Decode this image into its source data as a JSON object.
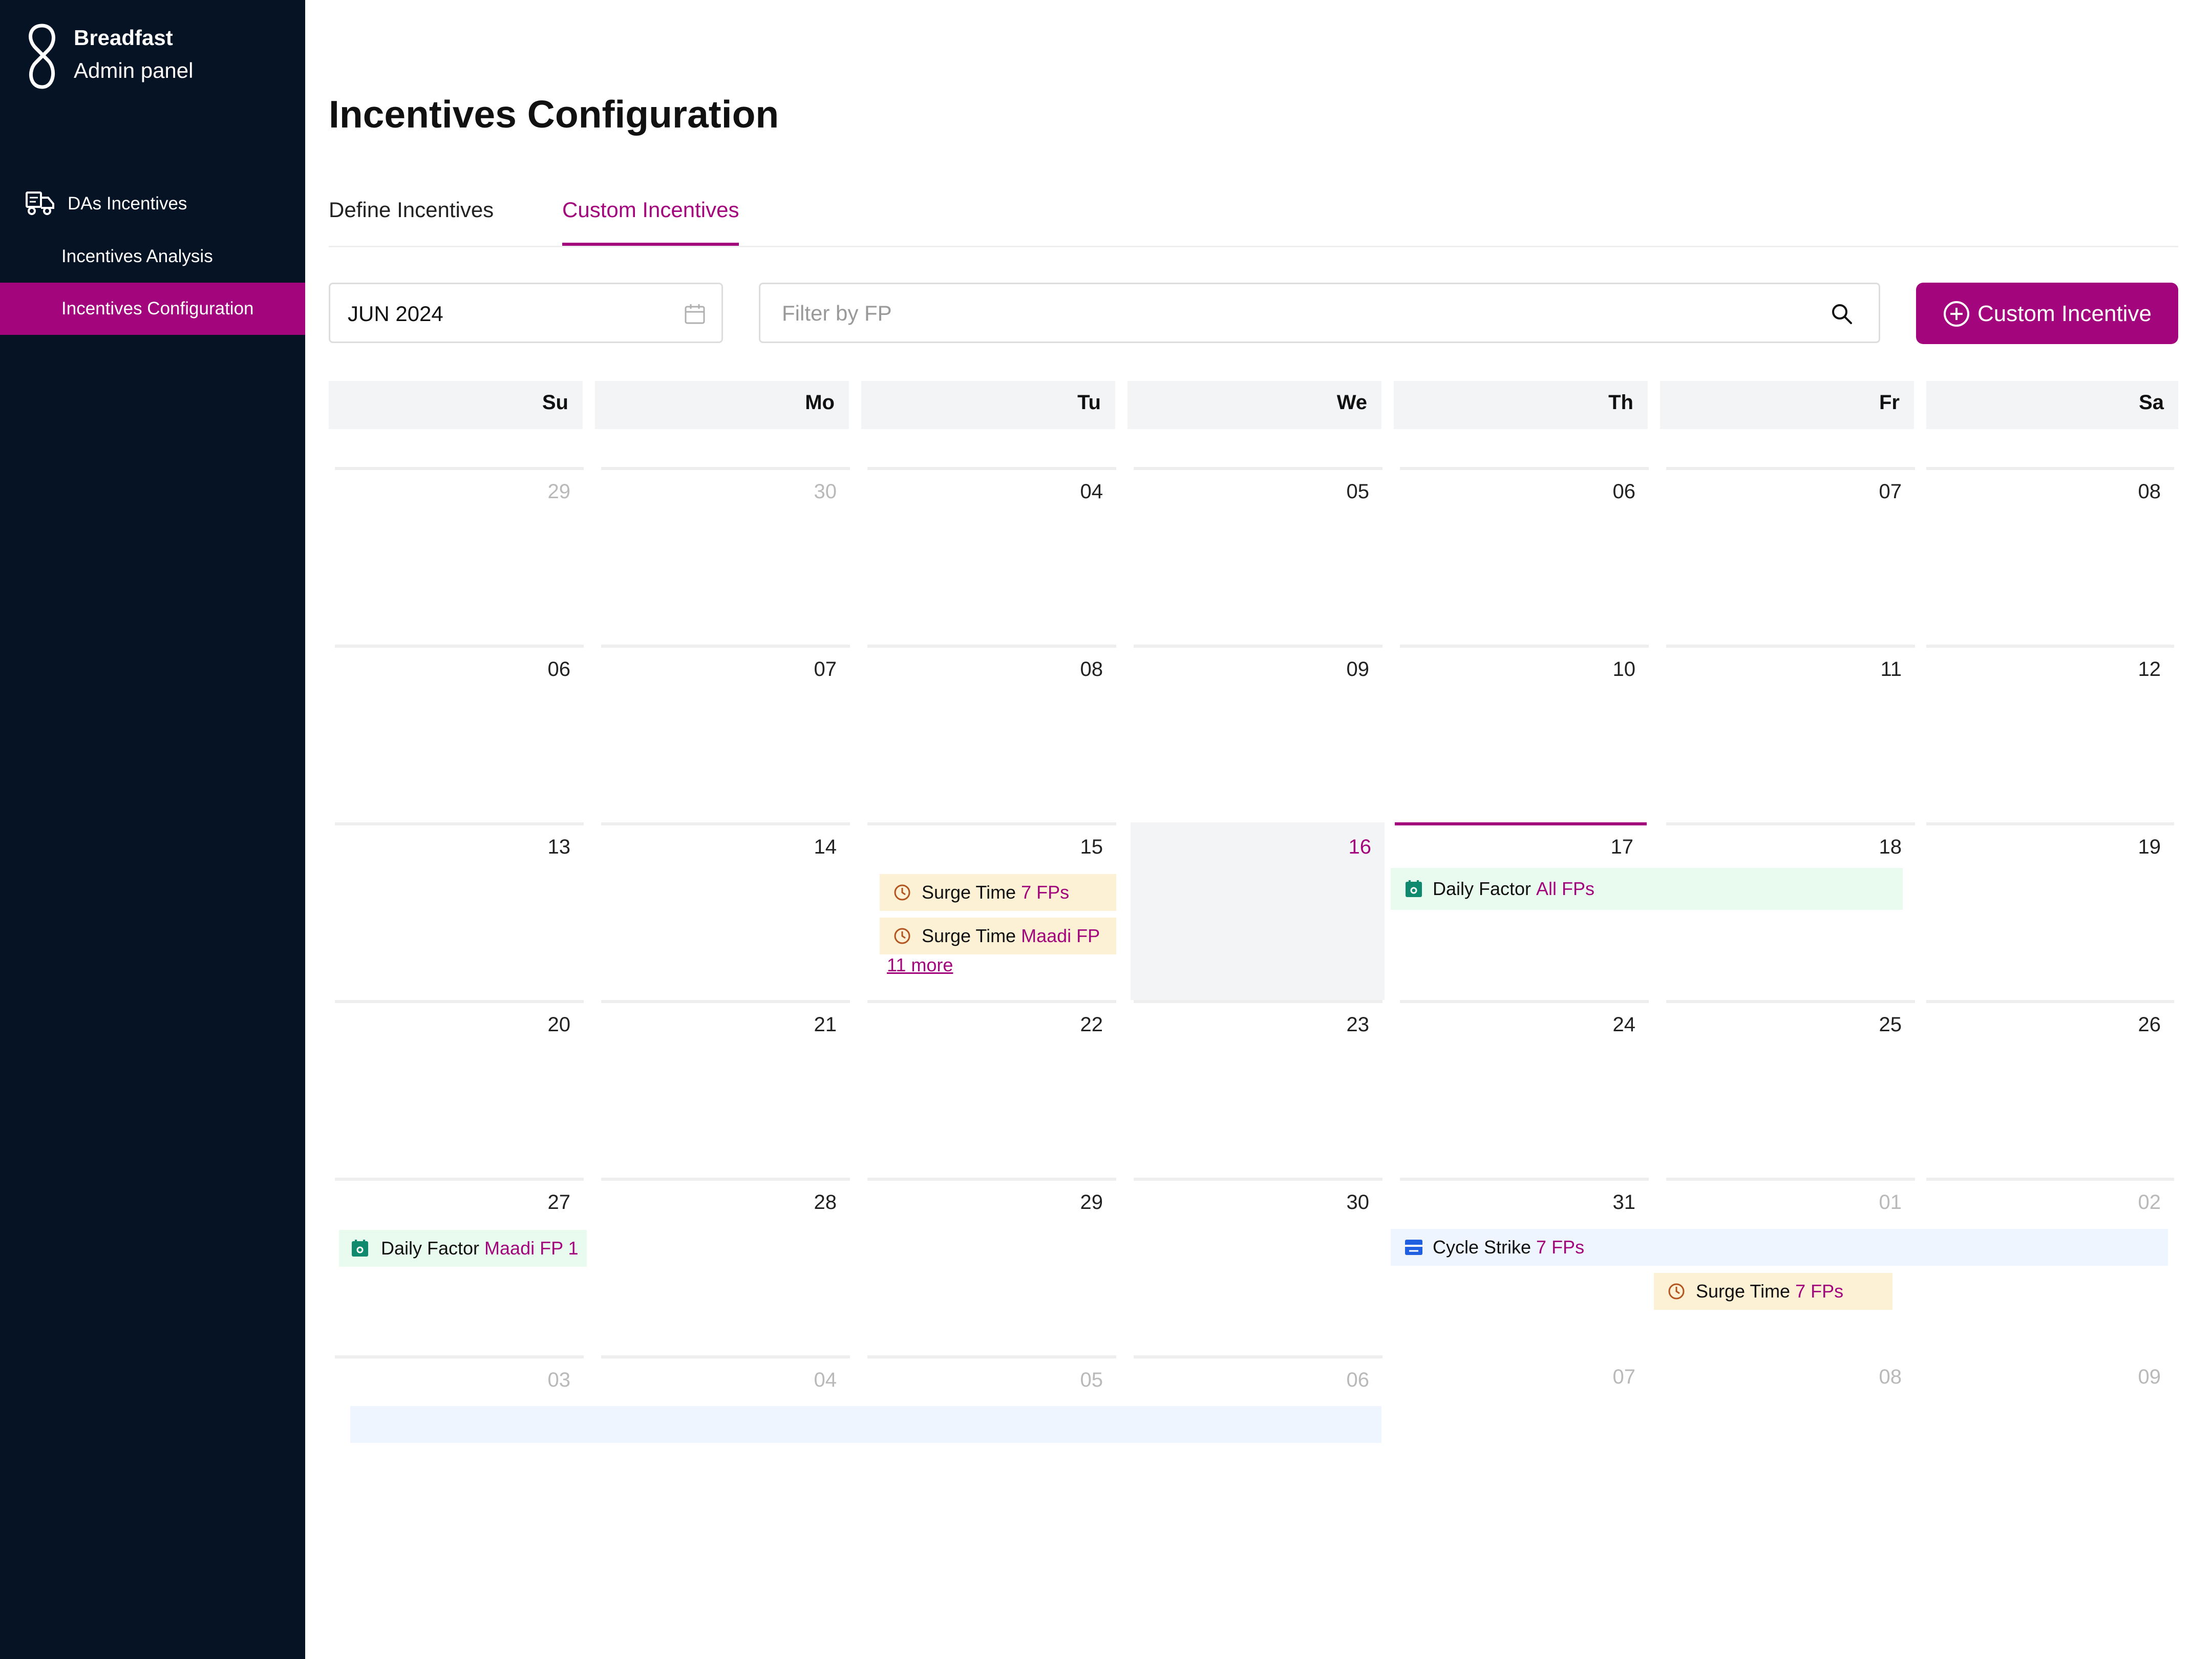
{
  "brand": {
    "name": "Breadfast",
    "subtitle": "Admin panel"
  },
  "sidebar": {
    "section": "DAs Incentives",
    "items": [
      {
        "label": "Incentives Analysis",
        "active": false
      },
      {
        "label": "Incentives Configuration",
        "active": true
      }
    ]
  },
  "page": {
    "title": "Incentives Configuration"
  },
  "tabs": [
    {
      "label": "Define Incentives",
      "active": false
    },
    {
      "label": "Custom Incentives",
      "active": true
    }
  ],
  "toolbar": {
    "month": "JUN 2024",
    "filter_placeholder": "Filter by FP",
    "add_label": "Custom Incentive"
  },
  "colors": {
    "accent": "#a3067c",
    "sidebar_bg": "#051324",
    "surge_bg": "#fcf1d4",
    "daily_bg": "#e8fbee",
    "cycle_bg": "#eef5fe"
  },
  "calendar": {
    "weekdays": [
      "Su",
      "Mo",
      "Tu",
      "We",
      "Th",
      "Fr",
      "Sa"
    ],
    "weeks": [
      [
        {
          "d": "29",
          "muted": true
        },
        {
          "d": "30",
          "muted": true
        },
        {
          "d": "04"
        },
        {
          "d": "05"
        },
        {
          "d": "06"
        },
        {
          "d": "07"
        },
        {
          "d": "08"
        }
      ],
      [
        {
          "d": "06"
        },
        {
          "d": "07"
        },
        {
          "d": "08"
        },
        {
          "d": "09"
        },
        {
          "d": "10"
        },
        {
          "d": "11"
        },
        {
          "d": "12"
        }
      ],
      [
        {
          "d": "13"
        },
        {
          "d": "14"
        },
        {
          "d": "15"
        },
        {
          "d": "16",
          "today": true
        },
        {
          "d": "17",
          "accent": true
        },
        {
          "d": "18"
        },
        {
          "d": "19"
        }
      ],
      [
        {
          "d": "20"
        },
        {
          "d": "21"
        },
        {
          "d": "22"
        },
        {
          "d": "23"
        },
        {
          "d": "24"
        },
        {
          "d": "25"
        },
        {
          "d": "26"
        }
      ],
      [
        {
          "d": "27"
        },
        {
          "d": "28"
        },
        {
          "d": "29"
        },
        {
          "d": "30"
        },
        {
          "d": "31"
        },
        {
          "d": "01",
          "muted": true
        },
        {
          "d": "02",
          "muted": true
        }
      ],
      [
        {
          "d": "03",
          "muted": true
        },
        {
          "d": "04",
          "muted": true
        },
        {
          "d": "05",
          "muted": true
        },
        {
          "d": "06",
          "muted": true
        },
        {
          "d": "07",
          "muted": true
        },
        {
          "d": "08",
          "muted": true
        },
        {
          "d": "09",
          "muted": true
        }
      ]
    ],
    "events": [
      {
        "type": "surge",
        "label": "Surge Time",
        "tag": "7 FPs",
        "icon": "clock-icon"
      },
      {
        "type": "surge",
        "label": "Surge Time",
        "tag": "Maadi FP",
        "icon": "clock-icon"
      },
      {
        "type": "daily",
        "label": "Daily Factor",
        "tag": "All FPs",
        "icon": "calendar-badge-icon"
      },
      {
        "type": "daily",
        "label": "Daily Factor",
        "tag": "Maadi FP 1",
        "icon": "calendar-badge-icon"
      },
      {
        "type": "cycle",
        "label": "Cycle Strike",
        "tag": "7 FPs",
        "icon": "cycle-strike-icon"
      },
      {
        "type": "surge",
        "label": "Surge Time",
        "tag": "7 FPs",
        "icon": "clock-icon"
      },
      {
        "type": "cycle",
        "label": "",
        "tag": "",
        "icon": ""
      }
    ],
    "more_label": "11 more"
  }
}
